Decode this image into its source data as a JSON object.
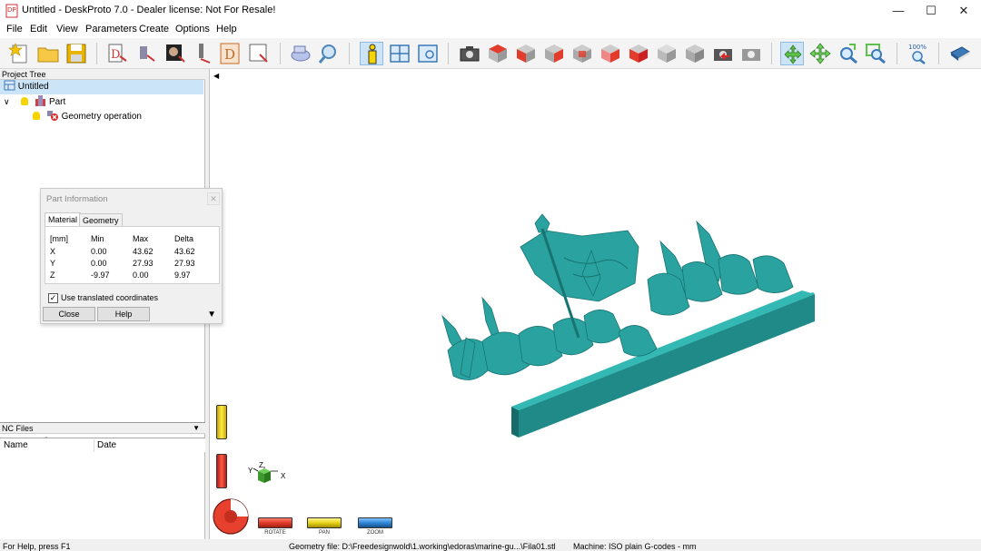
{
  "window": {
    "title": "Untitled - DeskProto 7.0 - Dealer license: Not For Resale!",
    "min_icon": "minimize-icon",
    "max_icon": "maximize-icon",
    "close_icon": "close-icon"
  },
  "menu": [
    "File",
    "Edit",
    "View",
    "Parameters",
    "Create",
    "Options",
    "Help"
  ],
  "project_tree": {
    "header": "Project Tree",
    "items": [
      {
        "label": "Untitled",
        "icon": "project-icon"
      },
      {
        "label": "Part",
        "icon": "part-icon"
      },
      {
        "label": "Geometry operation",
        "icon": "operation-error-icon"
      }
    ]
  },
  "nc_files": {
    "header": "NC Files",
    "columns": [
      "Name",
      "Date"
    ]
  },
  "part_info": {
    "title": "Part Information",
    "tabs": [
      "Material",
      "Geometry"
    ],
    "headers": [
      "[mm]",
      "Min",
      "Max",
      "Delta"
    ],
    "rows": [
      [
        "X",
        "0.00",
        "43.62",
        "43.62"
      ],
      [
        "Y",
        "0.00",
        "27.93",
        "27.93"
      ],
      [
        "Z",
        "-9.97",
        "0.00",
        "9.97"
      ]
    ],
    "checkbox_label": "Use translated coordinates",
    "checkbox_checked": true,
    "close_label": "Close",
    "help_label": "Help"
  },
  "axes": {
    "x": "X",
    "y": "Y",
    "z": "Z"
  },
  "view_modes": [
    {
      "label": "ROTATE",
      "color": "#e03a2a"
    },
    {
      "label": "PAN",
      "color": "#e8d21a"
    },
    {
      "label": "ZOOM",
      "color": "#2f86d6"
    }
  ],
  "status": {
    "help": "For Help, press F1",
    "geometry": "Geometry file: D:\\Freedesignwold\\1.working\\edoras\\marine-gu...\\Fila01.stl",
    "machine": "Machine: ISO plain G-codes - mm"
  },
  "colors": {
    "model": "#2aa3a0",
    "model_dark": "#197774",
    "highlight": "#cde4f7"
  }
}
